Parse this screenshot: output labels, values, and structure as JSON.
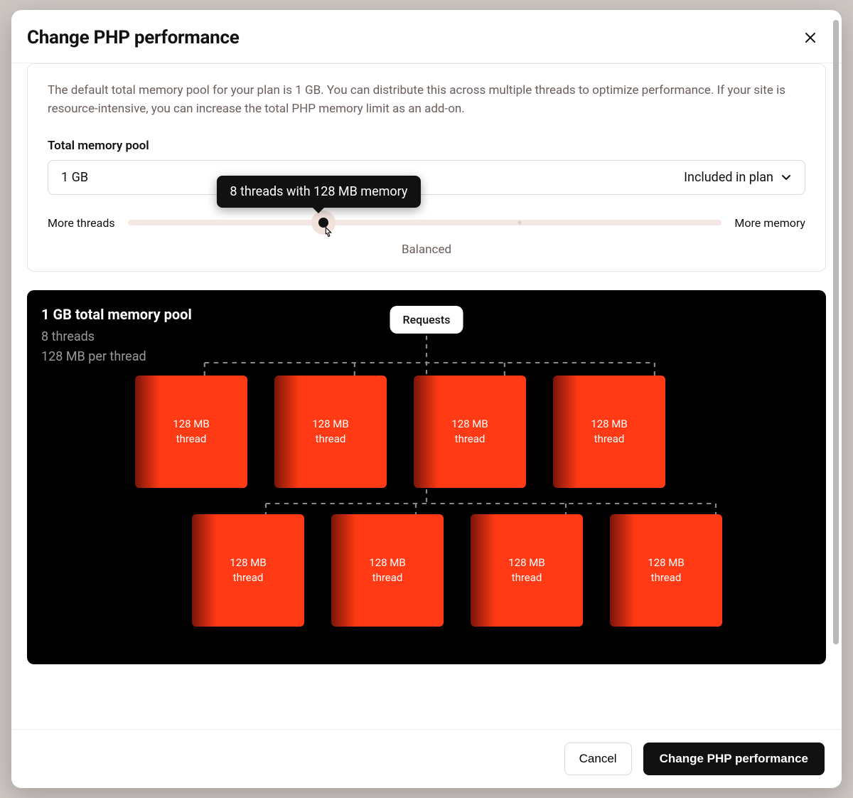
{
  "modal": {
    "title": "Change PHP performance",
    "description": "The default total memory pool for your plan is 1 GB. You can distribute this across multiple threads to optimize performance. If your site is resource-intensive, you can increase the total PHP memory limit as an add-on.",
    "memory_pool_label": "Total memory pool",
    "memory_pool_value": "1 GB",
    "memory_pool_plan_note": "Included in plan",
    "slider": {
      "left_label": "More threads",
      "right_label": "More memory",
      "balanced_label": "Balanced",
      "tooltip": "8 threads with 128 MB memory",
      "position_percent": 33,
      "ticks_percent": [
        33,
        66
      ]
    }
  },
  "viz": {
    "requests_label": "Requests",
    "title": "1 GB total memory pool",
    "threads_line": "8 threads",
    "per_thread_line": "128 MB per thread",
    "card_line1": "128 MB",
    "card_line2": "thread",
    "thread_count": 8
  },
  "footer": {
    "cancel": "Cancel",
    "confirm": "Change PHP performance"
  },
  "colors": {
    "accent": "#ff3a14",
    "tooltip_bg": "#111111",
    "muted_text": "#6b5f5b"
  }
}
